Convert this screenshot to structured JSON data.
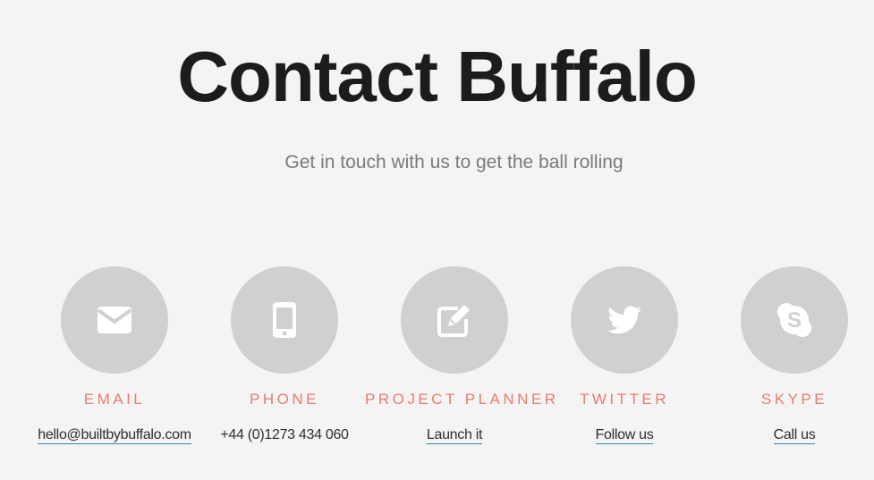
{
  "header": {
    "title": "Contact Buffalo",
    "subtitle": "Get in touch with us to get the ball rolling"
  },
  "contacts": [
    {
      "icon": "envelope-icon",
      "label": "EMAIL",
      "value": "hello@builtbybuffalo.com",
      "is_link": true
    },
    {
      "icon": "mobile-phone-icon",
      "label": "PHONE",
      "value": "+44 (0)1273 434 060",
      "is_link": false
    },
    {
      "icon": "edit-icon",
      "label": "PROJECT PLANNER",
      "value": "Launch it",
      "is_link": true
    },
    {
      "icon": "twitter-icon",
      "label": "TWITTER",
      "value": "Follow us",
      "is_link": true
    },
    {
      "icon": "skype-icon",
      "label": "SKYPE",
      "value": "Call us",
      "is_link": true
    }
  ],
  "colors": {
    "background": "#f4f4f4",
    "circle": "#d0d0d0",
    "label_accent": "#ea7b6f",
    "link_underline": "#3a86a3",
    "title": "#1c1c1c"
  }
}
